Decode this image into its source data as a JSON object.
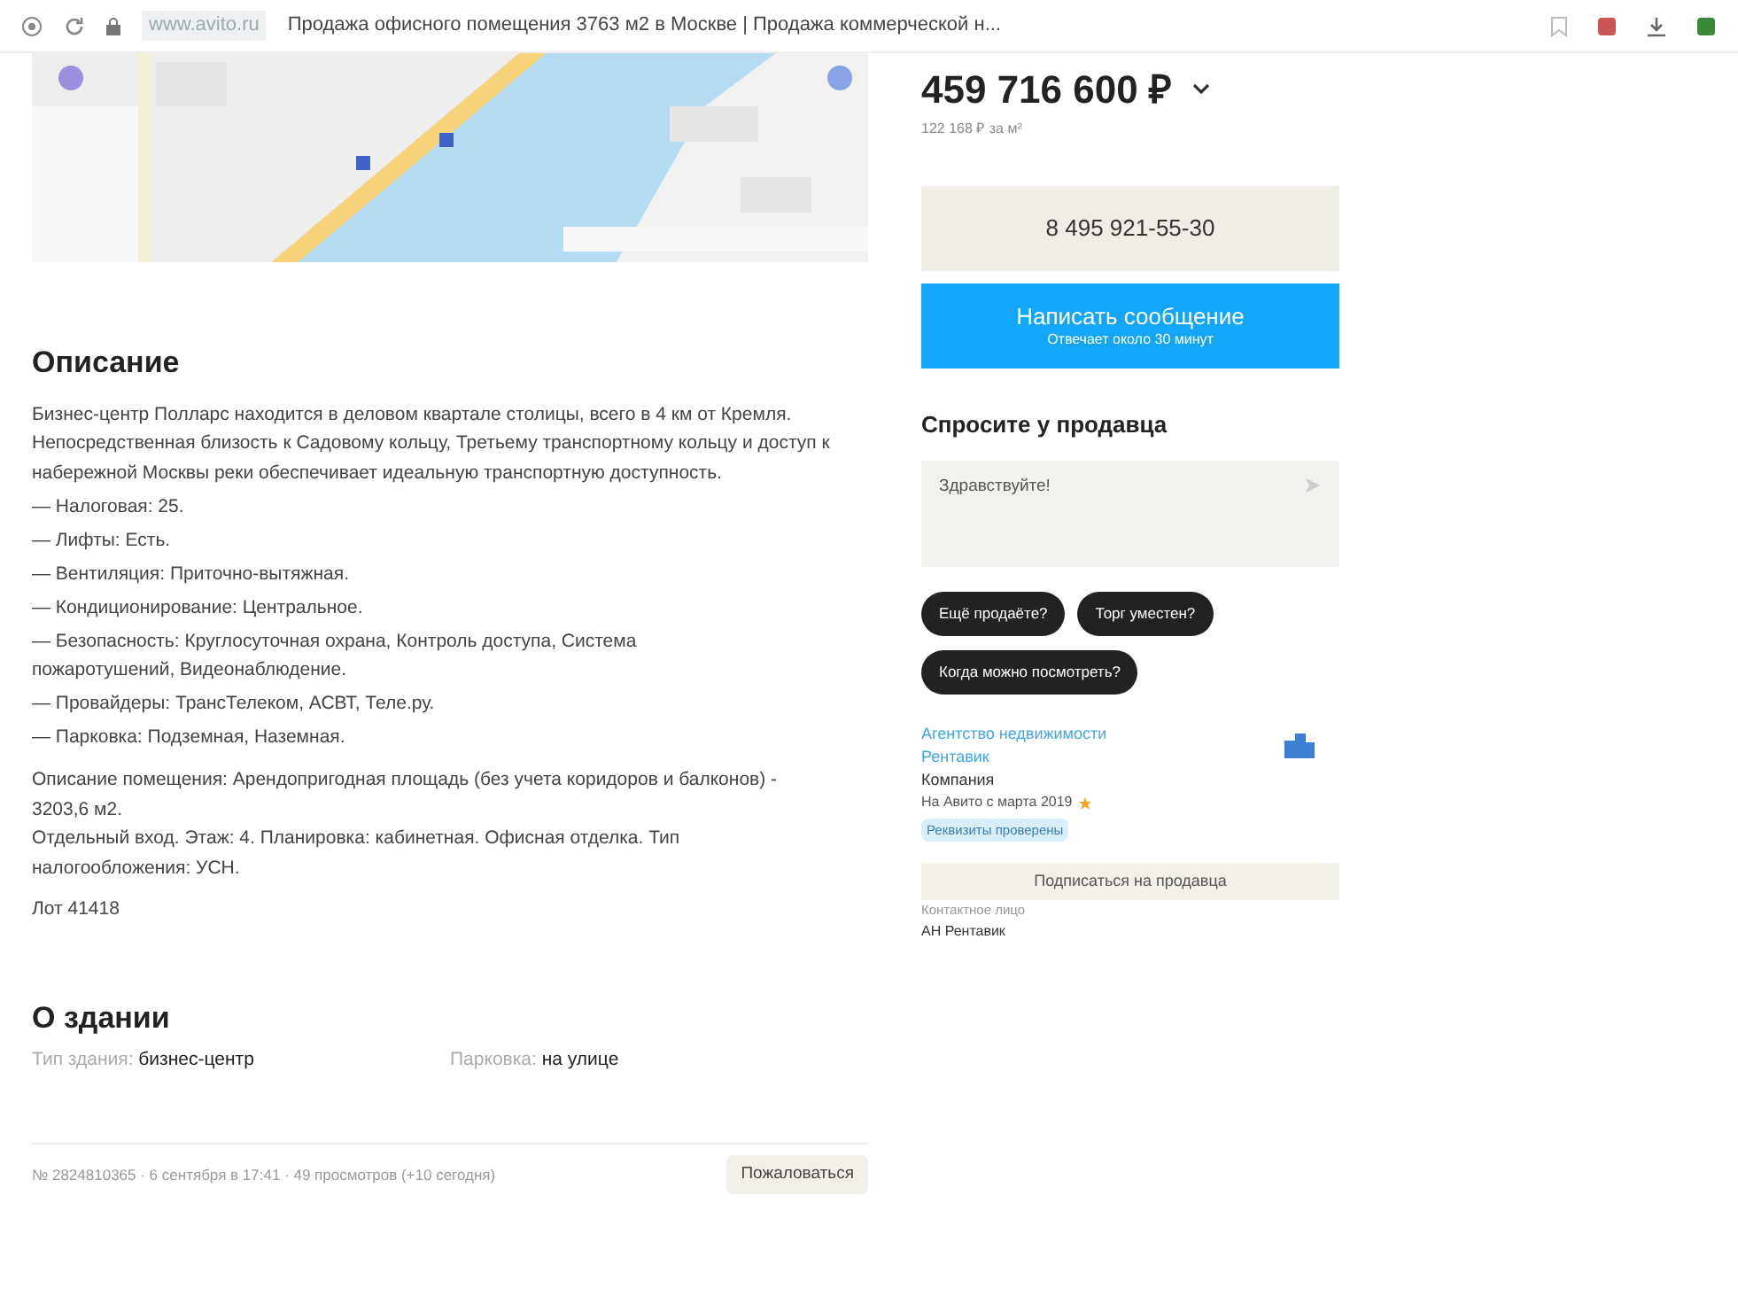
{
  "browser": {
    "url": "www.avito.ru",
    "title": "Продажа офисного помещения 3763 м2 в Москве | Продажа коммерческой н..."
  },
  "description": {
    "heading": "Описание",
    "intro": "Бизнес-центр Полларс находится в деловом квартале столицы, всего в 4 км от Кремля. Непосредственная близость к Садовому кольцу, Третьему транспортному кольцу и доступ к набережной Москвы реки обеспечивает идеальную транспортную доступность.",
    "items": [
      "— Налоговая: 25.",
      "— Лифты: Есть.",
      "— Вентиляция: Приточно-вытяжная.",
      "— Кондиционирование: Центральное.",
      "— Безопасность: Круглосуточная охрана, Контроль доступа, Система пожаротушений, Видеонаблюдение.",
      "— Провайдеры: ТрансТелеком, АСВТ, Теле.ру.",
      "— Парковка: Подземная, Наземная."
    ],
    "details": "Описание помещения: Арендопригодная площадь (без учета коридоров и балконов) - 3203,6 м2.\nОтдельный вход. Этаж: 4. Планировка: кабинетная. Офисная отделка. Тип налогообложения: УСН.",
    "lot": "Лот 41418"
  },
  "building": {
    "heading": "О здании",
    "params": [
      {
        "label": "Тип здания:",
        "value": "бизнес-центр"
      },
      {
        "label": "Парковка:",
        "value": "на улице"
      }
    ]
  },
  "footer": {
    "meta": "№ 2824810365 · 6 сентября в 17:41 · 49 просмотров (+10 сегодня)",
    "report": "Пожаловаться"
  },
  "price": {
    "value": "459 716 600 ₽",
    "per_meter": "122 168 ₽ за м²"
  },
  "phone": "8 495 921-55-30",
  "message_button": {
    "label": "Написать сообщение",
    "sub": "Отвечает около 30 минут"
  },
  "ask": {
    "heading": "Спросите у продавца",
    "placeholder": "Здравствуйте!",
    "chips": [
      "Ещё продаёте?",
      "Торг уместен?",
      "Когда можно посмотреть?"
    ]
  },
  "seller": {
    "name": "Агентство недвижимости Рентавик",
    "type": "Компания",
    "since": "На Авито с марта 2019",
    "badge": "Реквизиты проверены",
    "subscribe": "Подписаться на продавца",
    "contact_label": "Контактное лицо",
    "contact": "АН Рентавик"
  }
}
